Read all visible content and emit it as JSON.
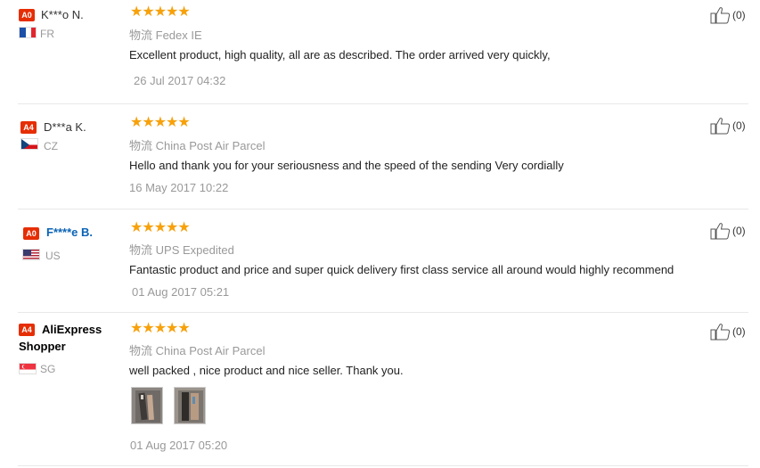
{
  "logistics_label": "物流",
  "helpful_count": "(0)",
  "stars": "★★★★★",
  "reviews": [
    {
      "badge": "A0",
      "name": "K***o N.",
      "country": "FR",
      "service": "Fedex IE",
      "comment": "Excellent product, high quality, all are as described. The order arrived very quickly,",
      "date": "26 Jul 2017 04:32",
      "rating": 5
    },
    {
      "badge": "A4",
      "name": "D***a K.",
      "country": "CZ",
      "service": "China Post Air Parcel",
      "comment": "Hello and thank you for your seriousness and the speed of the sending Very cordially",
      "date": "16 May 2017 10:22",
      "rating": 5
    },
    {
      "badge": "A0",
      "name": "F****e B.",
      "country": "US",
      "service": "UPS Expedited",
      "comment": "Fantastic product and price and super quick delivery first class service all around would highly recommend",
      "date": "01 Aug 2017 05:21",
      "rating": 5
    },
    {
      "badge": "A4",
      "name": "AliExpress Shopper",
      "country": "SG",
      "service": "China Post Air Parcel",
      "comment": "well packed , nice product and nice seller. Thank you.",
      "date": "01 Aug 2017 05:20",
      "rating": 5
    }
  ],
  "colors": {
    "star": "#f7a10b",
    "badge": "#e62e04",
    "link": "#0a63b5"
  }
}
